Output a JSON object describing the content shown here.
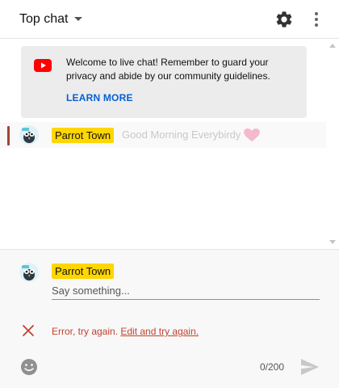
{
  "header": {
    "title": "Top chat",
    "icons": [
      "chevron-down-icon",
      "gear-icon",
      "more-vert-icon"
    ]
  },
  "welcome": {
    "icon": "youtube-icon",
    "message": "Welcome to live chat! Remember to guard your privacy and abide by our community guidelines.",
    "learn_more": "LEARN MORE"
  },
  "messages": [
    {
      "author": "Parrot Town",
      "text": "Good Morning Everybirdy",
      "icon": "heart-icon"
    }
  ],
  "composer": {
    "author": "Parrot Town",
    "placeholder": "Say something...",
    "error_text": "Error, try again.",
    "error_link": "Edit and try again.",
    "char_count": "0/200",
    "icons": [
      "close-icon",
      "emoji-icon",
      "send-icon"
    ]
  },
  "colors": {
    "author_chip": "#ffd600",
    "error": "#c2422f",
    "link": "#065fd4",
    "highlight_bar": "#a0433b",
    "heart": "#f4b9cc"
  }
}
